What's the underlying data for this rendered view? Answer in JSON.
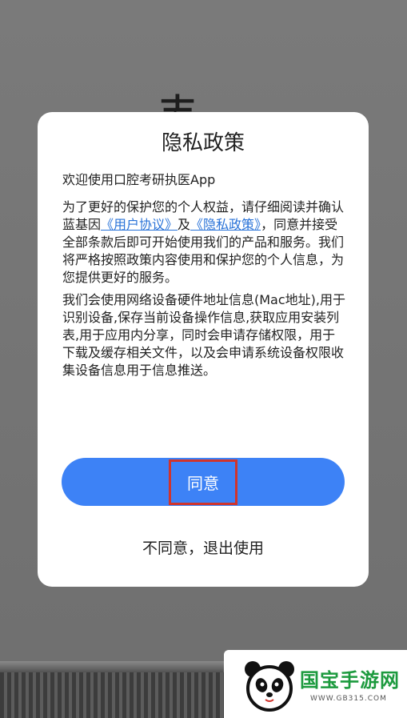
{
  "background": {
    "char": "志"
  },
  "dialog": {
    "title": "隐私政策",
    "welcome": "欢迎使用口腔考研执医App",
    "para1_a": "为了更好的保护您的个人权益，请仔细阅读并确认蓝基因",
    "link_user_agreement": "《用户协议》",
    "and": "及",
    "link_privacy_policy": "《隐私政策》",
    "para1_b": "，同意并接受全部条款后即可开始使用我们的产品和服务。我们将严格按照政策内容使用和保护您的个人信息，为您提供更好的服务。",
    "para2": "我们会使用网络设备硬件地址信息(Mac地址),用于识别设备,保存当前设备操作信息,获取应用安装列表,用于应用内分享，同时会申请存储权限，用于下载及缓存相关文件，以及会申请系统设备权限收集设备信息用于信息推送。",
    "agree_label": "同意",
    "disagree_label": "不同意，退出使用"
  },
  "watermark": {
    "name": "国宝手游网",
    "url": "WWW.GB315.COM"
  },
  "colors": {
    "accent": "#3d82f6",
    "link": "#2a73d8",
    "highlight_border": "#d0342c",
    "watermark_green": "#1c9a3e"
  }
}
